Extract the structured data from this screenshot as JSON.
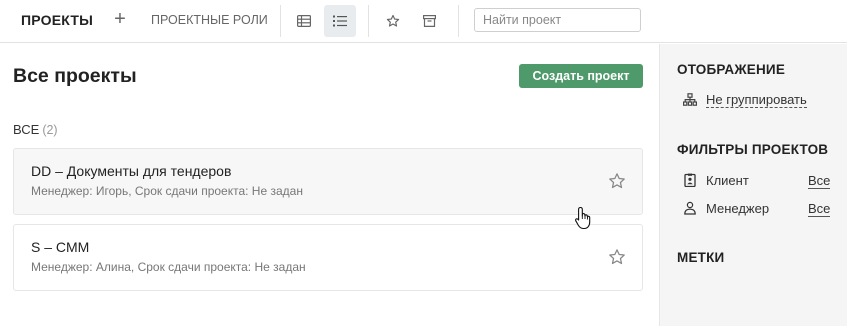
{
  "toolbar": {
    "title": "ПРОЕКТЫ",
    "add_icon": "plus-icon",
    "roles_label": "ПРОЕКТНЫЕ РОЛИ",
    "view_table_icon": "table-view-icon",
    "view_list_icon": "list-view-icon",
    "favorites_icon": "star-icon",
    "archive_icon": "archive-icon",
    "search_placeholder": "Найти проект",
    "search_value": ""
  },
  "main": {
    "title": "Все проекты",
    "create_button": "Создать проект",
    "group_label": "ВСЕ",
    "group_count": "(2)",
    "projects": [
      {
        "title": "DD – Документы для тендеров",
        "meta": "Менеджер: Игорь, Срок сдачи проекта: Не задан",
        "star_icon": "star-outline-icon"
      },
      {
        "title": "S – CMM",
        "meta": "Менеджер: Алина, Срок сдачи проекта: Не задан",
        "star_icon": "star-outline-icon"
      }
    ]
  },
  "sidebar": {
    "display_heading": "ОТОБРАЖЕНИЕ",
    "group_option": "Не группировать",
    "group_icon": "hierarchy-icon",
    "filters_heading": "ФИЛЬТРЫ ПРОЕКТОВ",
    "filters": [
      {
        "label": "Клиент",
        "value": "Все",
        "icon": "client-badge-icon"
      },
      {
        "label": "Менеджер",
        "value": "Все",
        "icon": "person-icon"
      }
    ],
    "tags_heading": "МЕТКИ"
  },
  "colors": {
    "accent_green": "#4f9a6b",
    "sidebar_bg": "#f5f5f5",
    "active_toggle_bg": "#e9ecef"
  }
}
